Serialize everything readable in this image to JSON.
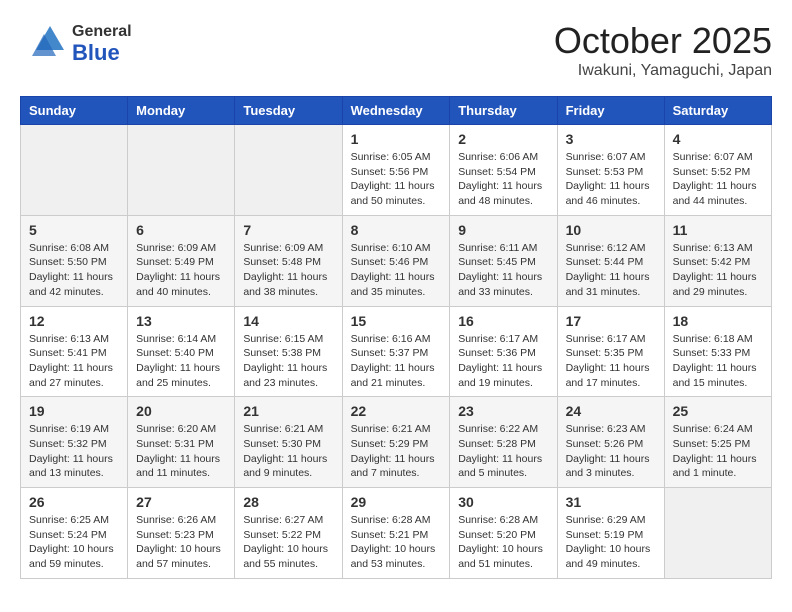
{
  "header": {
    "logo_line1_general": "General",
    "logo_line2_blue": "Blue",
    "month_title": "October 2025",
    "location": "Iwakuni, Yamaguchi, Japan"
  },
  "weekdays": [
    "Sunday",
    "Monday",
    "Tuesday",
    "Wednesday",
    "Thursday",
    "Friday",
    "Saturday"
  ],
  "weeks": [
    [
      {
        "day": "",
        "info": ""
      },
      {
        "day": "",
        "info": ""
      },
      {
        "day": "",
        "info": ""
      },
      {
        "day": "1",
        "info": "Sunrise: 6:05 AM\nSunset: 5:56 PM\nDaylight: 11 hours\nand 50 minutes."
      },
      {
        "day": "2",
        "info": "Sunrise: 6:06 AM\nSunset: 5:54 PM\nDaylight: 11 hours\nand 48 minutes."
      },
      {
        "day": "3",
        "info": "Sunrise: 6:07 AM\nSunset: 5:53 PM\nDaylight: 11 hours\nand 46 minutes."
      },
      {
        "day": "4",
        "info": "Sunrise: 6:07 AM\nSunset: 5:52 PM\nDaylight: 11 hours\nand 44 minutes."
      }
    ],
    [
      {
        "day": "5",
        "info": "Sunrise: 6:08 AM\nSunset: 5:50 PM\nDaylight: 11 hours\nand 42 minutes."
      },
      {
        "day": "6",
        "info": "Sunrise: 6:09 AM\nSunset: 5:49 PM\nDaylight: 11 hours\nand 40 minutes."
      },
      {
        "day": "7",
        "info": "Sunrise: 6:09 AM\nSunset: 5:48 PM\nDaylight: 11 hours\nand 38 minutes."
      },
      {
        "day": "8",
        "info": "Sunrise: 6:10 AM\nSunset: 5:46 PM\nDaylight: 11 hours\nand 35 minutes."
      },
      {
        "day": "9",
        "info": "Sunrise: 6:11 AM\nSunset: 5:45 PM\nDaylight: 11 hours\nand 33 minutes."
      },
      {
        "day": "10",
        "info": "Sunrise: 6:12 AM\nSunset: 5:44 PM\nDaylight: 11 hours\nand 31 minutes."
      },
      {
        "day": "11",
        "info": "Sunrise: 6:13 AM\nSunset: 5:42 PM\nDaylight: 11 hours\nand 29 minutes."
      }
    ],
    [
      {
        "day": "12",
        "info": "Sunrise: 6:13 AM\nSunset: 5:41 PM\nDaylight: 11 hours\nand 27 minutes."
      },
      {
        "day": "13",
        "info": "Sunrise: 6:14 AM\nSunset: 5:40 PM\nDaylight: 11 hours\nand 25 minutes."
      },
      {
        "day": "14",
        "info": "Sunrise: 6:15 AM\nSunset: 5:38 PM\nDaylight: 11 hours\nand 23 minutes."
      },
      {
        "day": "15",
        "info": "Sunrise: 6:16 AM\nSunset: 5:37 PM\nDaylight: 11 hours\nand 21 minutes."
      },
      {
        "day": "16",
        "info": "Sunrise: 6:17 AM\nSunset: 5:36 PM\nDaylight: 11 hours\nand 19 minutes."
      },
      {
        "day": "17",
        "info": "Sunrise: 6:17 AM\nSunset: 5:35 PM\nDaylight: 11 hours\nand 17 minutes."
      },
      {
        "day": "18",
        "info": "Sunrise: 6:18 AM\nSunset: 5:33 PM\nDaylight: 11 hours\nand 15 minutes."
      }
    ],
    [
      {
        "day": "19",
        "info": "Sunrise: 6:19 AM\nSunset: 5:32 PM\nDaylight: 11 hours\nand 13 minutes."
      },
      {
        "day": "20",
        "info": "Sunrise: 6:20 AM\nSunset: 5:31 PM\nDaylight: 11 hours\nand 11 minutes."
      },
      {
        "day": "21",
        "info": "Sunrise: 6:21 AM\nSunset: 5:30 PM\nDaylight: 11 hours\nand 9 minutes."
      },
      {
        "day": "22",
        "info": "Sunrise: 6:21 AM\nSunset: 5:29 PM\nDaylight: 11 hours\nand 7 minutes."
      },
      {
        "day": "23",
        "info": "Sunrise: 6:22 AM\nSunset: 5:28 PM\nDaylight: 11 hours\nand 5 minutes."
      },
      {
        "day": "24",
        "info": "Sunrise: 6:23 AM\nSunset: 5:26 PM\nDaylight: 11 hours\nand 3 minutes."
      },
      {
        "day": "25",
        "info": "Sunrise: 6:24 AM\nSunset: 5:25 PM\nDaylight: 11 hours\nand 1 minute."
      }
    ],
    [
      {
        "day": "26",
        "info": "Sunrise: 6:25 AM\nSunset: 5:24 PM\nDaylight: 10 hours\nand 59 minutes."
      },
      {
        "day": "27",
        "info": "Sunrise: 6:26 AM\nSunset: 5:23 PM\nDaylight: 10 hours\nand 57 minutes."
      },
      {
        "day": "28",
        "info": "Sunrise: 6:27 AM\nSunset: 5:22 PM\nDaylight: 10 hours\nand 55 minutes."
      },
      {
        "day": "29",
        "info": "Sunrise: 6:28 AM\nSunset: 5:21 PM\nDaylight: 10 hours\nand 53 minutes."
      },
      {
        "day": "30",
        "info": "Sunrise: 6:28 AM\nSunset: 5:20 PM\nDaylight: 10 hours\nand 51 minutes."
      },
      {
        "day": "31",
        "info": "Sunrise: 6:29 AM\nSunset: 5:19 PM\nDaylight: 10 hours\nand 49 minutes."
      },
      {
        "day": "",
        "info": ""
      }
    ]
  ]
}
